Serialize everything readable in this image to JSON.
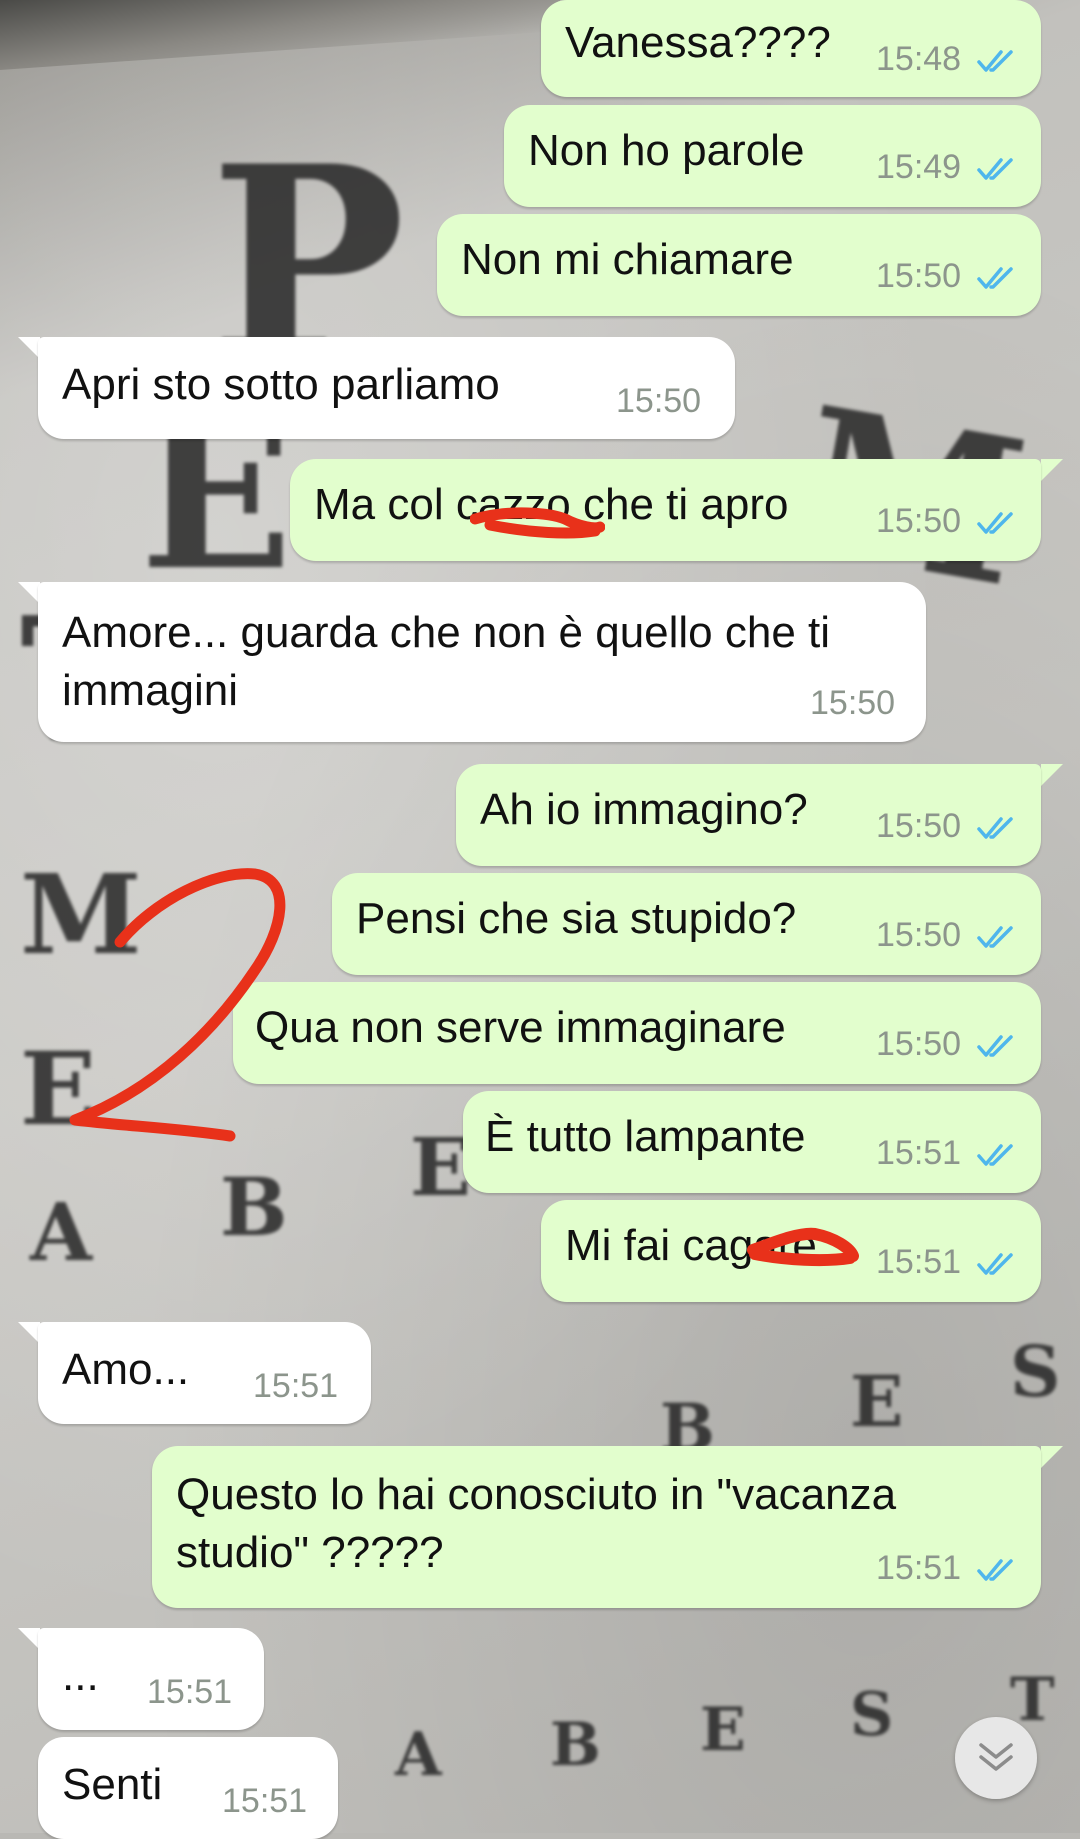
{
  "messages": [
    {
      "dir": "out",
      "text": "Vanessa????",
      "time": "15:48"
    },
    {
      "dir": "out",
      "text": "Non ho parole",
      "time": "15:49"
    },
    {
      "dir": "out",
      "text": "Non mi chiamare",
      "time": "15:50"
    },
    {
      "dir": "in",
      "text": "Apri sto sotto parliamo",
      "time": "15:50"
    },
    {
      "dir": "out",
      "text": "Ma col cazzo che ti apro",
      "time": "15:50"
    },
    {
      "dir": "in",
      "text": "Amore... guarda che non è quello che ti immagini",
      "time": "15:50"
    },
    {
      "dir": "out",
      "text": "Ah io immagino?",
      "time": "15:50"
    },
    {
      "dir": "out",
      "text": "Pensi che sia stupido?",
      "time": "15:50"
    },
    {
      "dir": "out",
      "text": "Qua non serve immaginare",
      "time": "15:50"
    },
    {
      "dir": "out",
      "text": "È tutto lampante",
      "time": "15:51"
    },
    {
      "dir": "out",
      "text": "Mi fai cagare",
      "time": "15:51"
    },
    {
      "dir": "in",
      "text": "Amo...",
      "time": "15:51"
    },
    {
      "dir": "out",
      "text": "Questo lo hai conosciuto in \"vacanza studio\" ?????",
      "time": "15:51"
    },
    {
      "dir": "in",
      "text": "...",
      "time": "15:51"
    },
    {
      "dir": "in",
      "text": "Senti",
      "time": "15:51"
    }
  ],
  "annotation": {
    "text": "2",
    "color": "#e8311a"
  },
  "colors": {
    "outgoing": "#e2fecd",
    "incoming": "#ffffff",
    "read_ticks": "#4fb6ec",
    "redaction": "#e8311a"
  },
  "icons": {
    "ticks": "double-check-icon",
    "scroll": "chevron-down-double-icon"
  }
}
